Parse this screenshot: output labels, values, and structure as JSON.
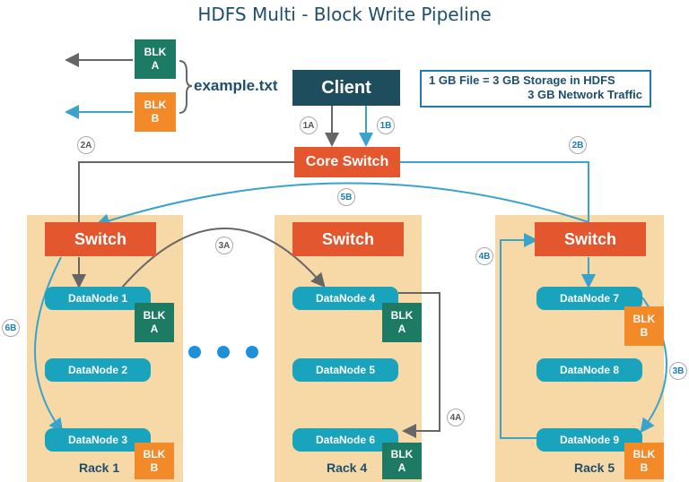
{
  "title": "HDFS Multi - Block Write Pipeline",
  "client": "Client",
  "core_switch": "Core Switch",
  "file_name": "example.txt",
  "info": {
    "line1": "1 GB File = 3 GB Storage in HDFS",
    "line2": "3 GB Network Traffic"
  },
  "file_blocks": [
    {
      "line1": "BLK",
      "line2": "A"
    },
    {
      "line1": "BLK",
      "line2": "B"
    }
  ],
  "racks": [
    {
      "label": "Rack 1",
      "switch": "Switch",
      "nodes": [
        "DataNode 1",
        "DataNode 2",
        "DataNode 3"
      ]
    },
    {
      "label": "Rack 4",
      "switch": "Switch",
      "nodes": [
        "DataNode 4",
        "DataNode 5",
        "DataNode 6"
      ]
    },
    {
      "label": "Rack 5",
      "switch": "Switch",
      "nodes": [
        "DataNode 7",
        "DataNode 8",
        "DataNode 9"
      ]
    }
  ],
  "node_blocks": [
    {
      "line1": "BLK",
      "line2": "A"
    },
    {
      "line1": "BLK",
      "line2": "B"
    },
    {
      "line1": "BLK",
      "line2": "A"
    },
    {
      "line1": "BLK",
      "line2": "A"
    },
    {
      "line1": "BLK",
      "line2": "B"
    },
    {
      "line1": "BLK",
      "line2": "B"
    }
  ],
  "steps": [
    "1A",
    "1B",
    "2A",
    "2B",
    "3A",
    "3B",
    "4A",
    "4B",
    "5B",
    "6B"
  ],
  "colors": {
    "block_a": "#1e7b63",
    "block_b": "#f28a2a",
    "switch": "#e4572e",
    "node": "#1aa3bc",
    "rack": "#f6d9a6",
    "path_a": "#666666",
    "path_b": "#3aa3cc"
  }
}
